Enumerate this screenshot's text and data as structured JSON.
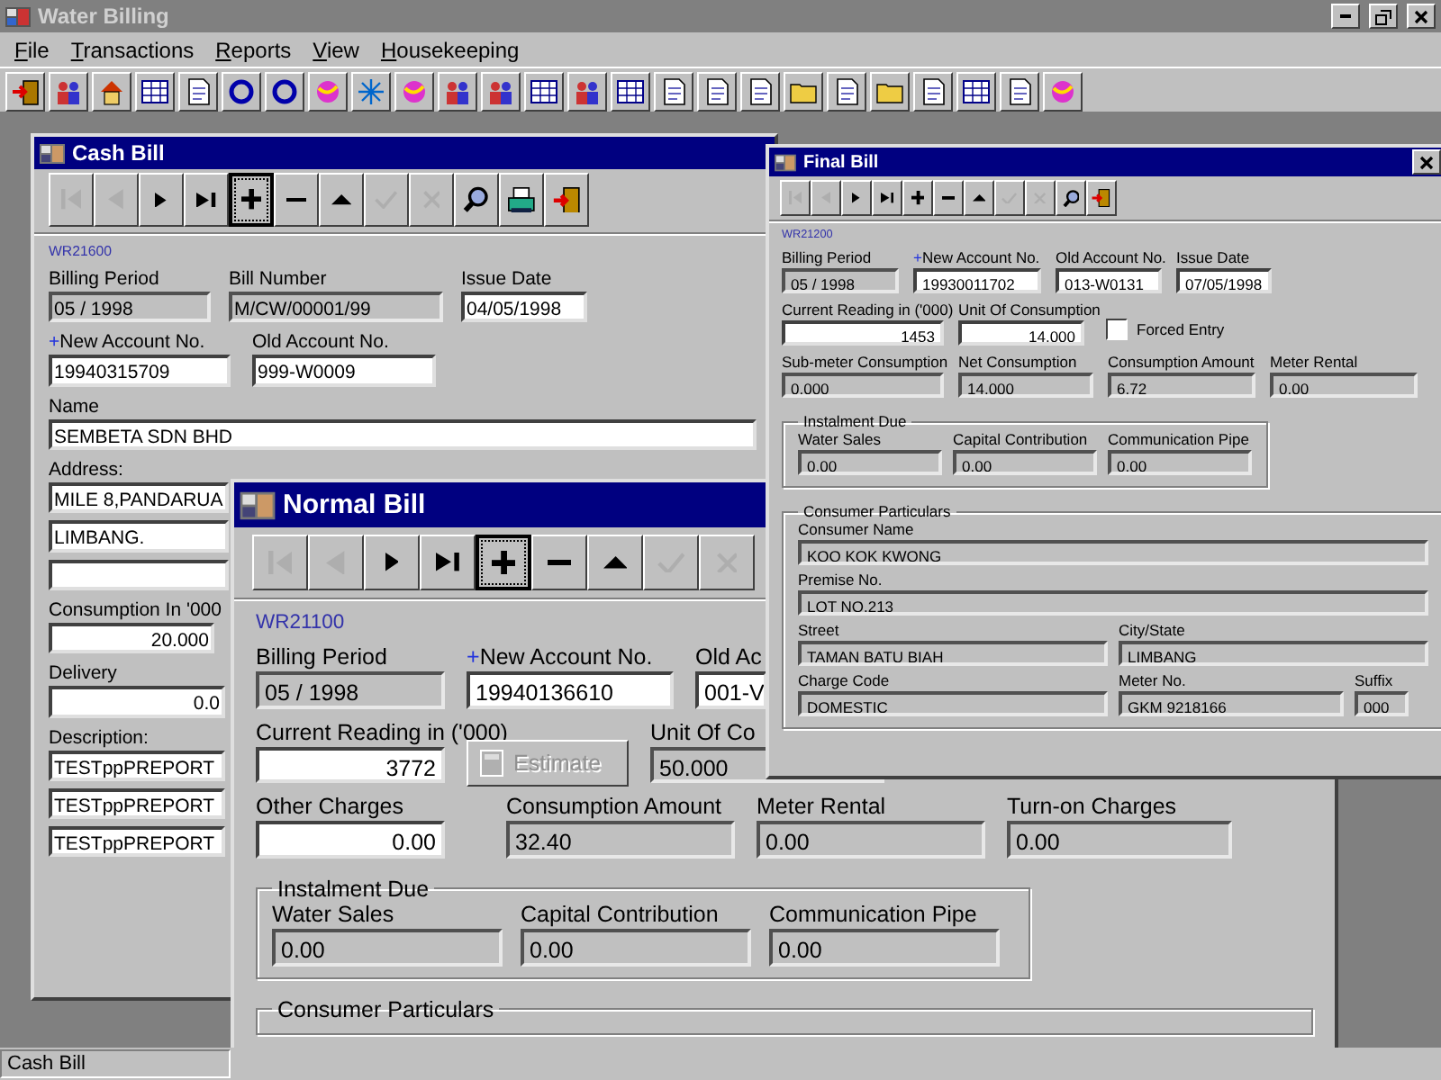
{
  "window": {
    "title": "Water Billing"
  },
  "menu": [
    "File",
    "Transactions",
    "Reports",
    "View",
    "Housekeeping"
  ],
  "cash_bill": {
    "title": "Cash Bill",
    "toolbar": [
      {
        "kind": "first",
        "disabled": true,
        "focused": false
      },
      {
        "kind": "prev",
        "disabled": true,
        "focused": false
      },
      {
        "kind": "next",
        "disabled": false,
        "focused": false
      },
      {
        "kind": "last",
        "disabled": false,
        "focused": false
      },
      {
        "kind": "plus",
        "disabled": false,
        "focused": true
      },
      {
        "kind": "minus",
        "disabled": false,
        "focused": false
      },
      {
        "kind": "up",
        "disabled": false,
        "focused": false
      },
      {
        "kind": "check",
        "disabled": true,
        "focused": false
      },
      {
        "kind": "cross",
        "disabled": true,
        "focused": false
      },
      {
        "kind": "search",
        "disabled": false,
        "focused": false
      },
      {
        "kind": "print",
        "disabled": false,
        "focused": false
      },
      {
        "kind": "exit",
        "disabled": false,
        "focused": false
      }
    ],
    "form_code": "WR21600",
    "billing_period": {
      "label": "Billing Period",
      "value": "05 / 1998",
      "readonly": true
    },
    "bill_number": {
      "label": "Bill Number",
      "value": "M/CW/00001/99",
      "readonly": true
    },
    "issue_date": {
      "label": "Issue Date",
      "value": "04/05/1998",
      "readonly": false
    },
    "new_account": {
      "mark": "+",
      "label": "New Account No.",
      "value": "19940315709",
      "readonly": false
    },
    "old_account": {
      "label": "Old Account No.",
      "value": "999-W0009",
      "readonly": false
    },
    "name": {
      "label": "Name",
      "value": "SEMBETA SDN BHD",
      "readonly": false
    },
    "address": {
      "label": "Address:",
      "lines": [
        "MILE 8,PANDARUA",
        "LIMBANG."
      ],
      "readonly": false
    },
    "consumption": {
      "label": "Consumption In '000",
      "value": "20.000",
      "kind": "numeric",
      "readonly": false
    },
    "delivery": {
      "label": "Delivery",
      "value": "0.0",
      "kind": "numeric",
      "readonly": false
    },
    "description": {
      "label": "Description:",
      "lines": [
        "TESTppPREPORT",
        "TESTppPREPORT",
        "TESTppPREPORT"
      ],
      "readonly": false
    }
  },
  "normal_bill": {
    "title": "Normal Bill",
    "toolbar": [
      {
        "kind": "first",
        "disabled": true,
        "focused": false
      },
      {
        "kind": "prev",
        "disabled": true,
        "focused": false
      },
      {
        "kind": "next",
        "disabled": false,
        "focused": false
      },
      {
        "kind": "last",
        "disabled": false,
        "focused": false
      },
      {
        "kind": "plus",
        "disabled": false,
        "focused": true
      },
      {
        "kind": "minus",
        "disabled": false,
        "focused": false
      },
      {
        "kind": "up",
        "disabled": false,
        "focused": false
      },
      {
        "kind": "check",
        "disabled": true,
        "focused": false
      },
      {
        "kind": "cross",
        "disabled": true,
        "focused": false
      }
    ],
    "form_code": "WR21100",
    "billing_period": {
      "label": "Billing Period",
      "value": "05 / 1998",
      "readonly": true
    },
    "new_account": {
      "mark": "+",
      "label": "New Account No.",
      "value": "19940136610",
      "readonly": false
    },
    "old_account": {
      "label": "Old Ac",
      "value": "001-V",
      "readonly": false
    },
    "current_reading": {
      "label": "Current Reading in ('000)",
      "value": "3772",
      "kind": "numeric",
      "readonly": false
    },
    "estimate_button": {
      "label": "Estimate",
      "disabled": true
    },
    "unit_of_consumption": {
      "label": "Unit Of Co",
      "value": "50.000",
      "readonly": true
    },
    "other_charges": {
      "label": "Other Charges",
      "value": "0.00",
      "kind": "numeric",
      "readonly": false
    },
    "consumption_amount": {
      "label": "Consumption Amount",
      "value": "32.40",
      "readonly": true
    },
    "meter_rental": {
      "label": "Meter Rental",
      "value": "0.00",
      "readonly": true
    },
    "turn_on_charges": {
      "label": "Turn-on Charges",
      "value": "0.00",
      "readonly": true
    },
    "instalment_due": {
      "title": "Instalment Due",
      "fields": [
        {
          "label": "Water Sales",
          "value": "0.00",
          "readonly": true
        },
        {
          "label": "Capital Contribution",
          "value": "0.00",
          "readonly": true
        },
        {
          "label": "Communication Pipe",
          "value": "0.00",
          "readonly": true
        }
      ]
    },
    "consumer_particulars": {
      "title": "Consumer Particulars"
    }
  },
  "final_bill": {
    "title": "Final Bill",
    "toolbar": [
      {
        "kind": "first",
        "disabled": true,
        "focused": false
      },
      {
        "kind": "prev",
        "disabled": true,
        "focused": false
      },
      {
        "kind": "next",
        "disabled": false,
        "focused": false
      },
      {
        "kind": "last",
        "disabled": false,
        "focused": false
      },
      {
        "kind": "plus",
        "disabled": false,
        "focused": false
      },
      {
        "kind": "minus",
        "disabled": false,
        "focused": false
      },
      {
        "kind": "up",
        "disabled": false,
        "focused": false
      },
      {
        "kind": "check",
        "disabled": true,
        "focused": false
      },
      {
        "kind": "cross",
        "disabled": true,
        "focused": false
      },
      {
        "kind": "search",
        "disabled": false,
        "focused": false
      },
      {
        "kind": "exit",
        "disabled": false,
        "focused": false
      }
    ],
    "form_code": "WR21200",
    "billing_period": {
      "label": "Billing Period",
      "value": "05 / 1998",
      "readonly": true
    },
    "new_account": {
      "mark": "+",
      "label": "New Account No.",
      "value": "19930011702",
      "readonly": false
    },
    "old_account": {
      "label": "Old Account No.",
      "value": "013-W0131",
      "readonly": false
    },
    "issue_date": {
      "label": "Issue Date",
      "value": "07/05/1998",
      "readonly": false
    },
    "current_reading": {
      "label": "Current Reading in ('000)",
      "value": "1453",
      "kind": "numeric",
      "readonly": false
    },
    "unit_of_consumption": {
      "label": "Unit Of Consumption",
      "value": "14.000",
      "kind": "numeric",
      "readonly": false
    },
    "forced_entry": {
      "label": "Forced Entry",
      "checked": false
    },
    "sub_meter_consumption": {
      "label": "Sub-meter Consumption",
      "value": "0.000",
      "readonly": true
    },
    "net_consumption": {
      "label": "Net Consumption",
      "value": "14.000",
      "readonly": true
    },
    "consumption_amount": {
      "label": "Consumption Amount",
      "value": "6.72",
      "readonly": true
    },
    "meter_rental": {
      "label": "Meter Rental",
      "value": "0.00",
      "readonly": true
    },
    "instalment_due": {
      "title": "Instalment Due",
      "fields": [
        {
          "label": "Water Sales",
          "value": "0.00",
          "readonly": true
        },
        {
          "label": "Capital Contribution",
          "value": "0.00",
          "readonly": true
        },
        {
          "label": "Communication Pipe",
          "value": "0.00",
          "readonly": true
        }
      ]
    },
    "consumer_particulars": {
      "title": "Consumer Particulars",
      "consumer_name": {
        "label": "Consumer Name",
        "value": "KOO KOK KWONG",
        "readonly": true
      },
      "premise_no": {
        "label": "Premise No.",
        "value": "LOT NO.213",
        "readonly": true
      },
      "street": {
        "label": "Street",
        "value": "TAMAN BATU BIAH",
        "readonly": true
      },
      "city_state": {
        "label": "City/State",
        "value": "LIMBANG",
        "readonly": true
      },
      "charge_code": {
        "label": "Charge Code",
        "value": "DOMESTIC",
        "readonly": true
      },
      "meter_no": {
        "label": "Meter No.",
        "value": "GKM 9218166",
        "readonly": true
      },
      "suffix": {
        "label": "Suffix",
        "value": "000",
        "readonly": true
      }
    }
  },
  "status_bar": "Cash Bill"
}
